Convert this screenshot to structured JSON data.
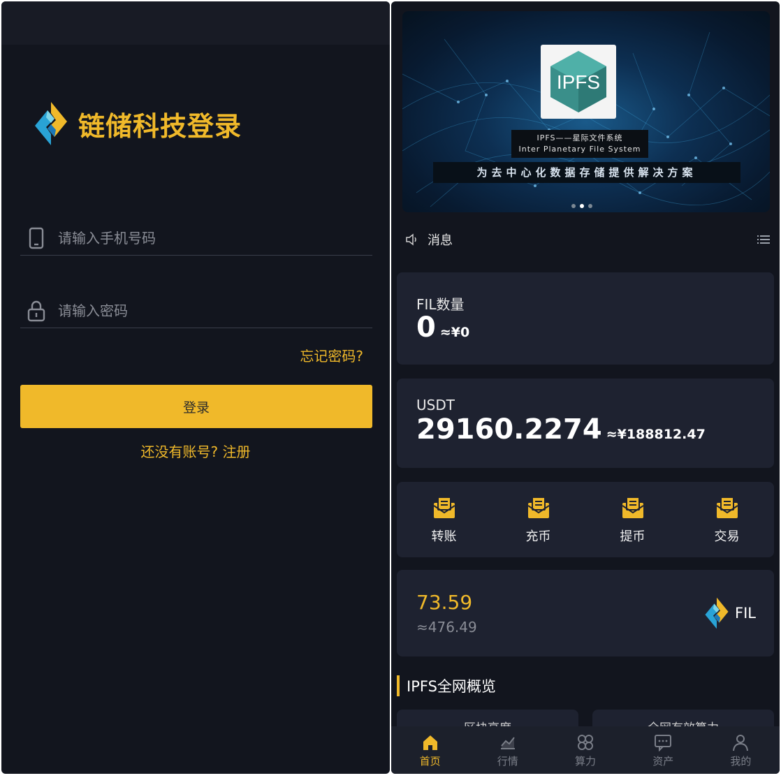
{
  "colors": {
    "accent": "#f0b92a",
    "panel": "#12151e",
    "card": "#1e2230",
    "tabbar": "#1c202b"
  },
  "login": {
    "title": "链储科技登录",
    "phone_placeholder": "请输入手机号码",
    "password_placeholder": "请输入密码",
    "forgot": "忘记密码?",
    "submit": "登录",
    "no_account": "还没有账号? ",
    "register": "注册"
  },
  "banner": {
    "logo_text": "IPFS",
    "subtitle_cn": "IPFS——星际文件系统",
    "subtitle_en": "Inter Planetary File System",
    "slogan": "为去中心化数据存储提供解决方案",
    "active_slide": 2,
    "slide_count": 3
  },
  "notice": {
    "label": "消息",
    "icon": "speaker-icon",
    "menu_icon": "list-icon"
  },
  "wallet": {
    "fil": {
      "label": "FIL数量",
      "amount": "0",
      "approx": "≈¥0"
    },
    "usdt": {
      "label": "USDT",
      "amount": "29160.2274",
      "approx": "≈¥188812.47"
    }
  },
  "actions": [
    {
      "label": "转账",
      "icon": "transfer-icon"
    },
    {
      "label": "充币",
      "icon": "deposit-icon"
    },
    {
      "label": "提币",
      "icon": "withdraw-icon"
    },
    {
      "label": "交易",
      "icon": "trade-icon"
    }
  ],
  "price": {
    "value": "73.59",
    "approx": "≈476.49",
    "coin": "FIL"
  },
  "overview": {
    "title": "IPFS全网概览",
    "cards": [
      "区块高度",
      "全网有效算力"
    ]
  },
  "tabs": [
    {
      "label": "首页",
      "icon": "home-icon",
      "active": true
    },
    {
      "label": "行情",
      "icon": "market-chart-icon",
      "active": false
    },
    {
      "label": "算力",
      "icon": "hashrate-icon",
      "active": false
    },
    {
      "label": "资产",
      "icon": "assets-icon",
      "active": false
    },
    {
      "label": "我的",
      "icon": "user-icon",
      "active": false
    }
  ]
}
